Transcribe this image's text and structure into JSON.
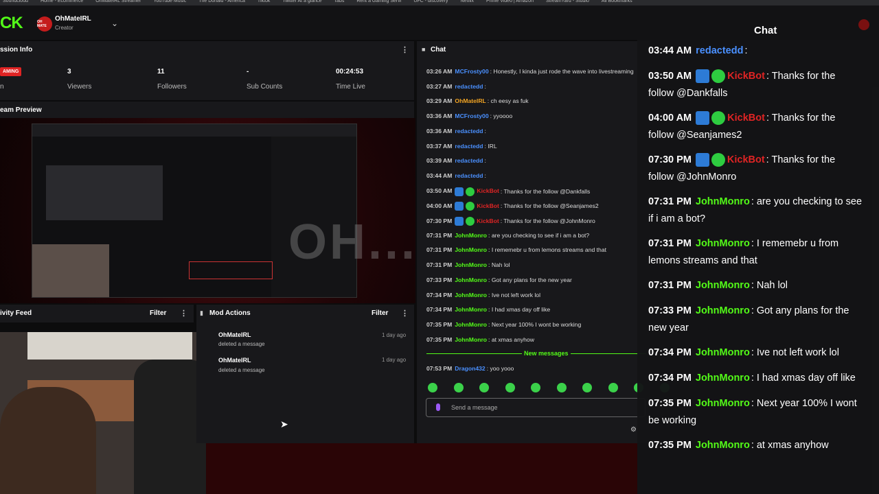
{
  "bookmarks": [
    "Soundcloud",
    "Home - Ecommerce",
    "OhMateIRL Streamer",
    "YouTube Music",
    "The Donald - America",
    "Tiktok",
    "Twitter At a glance",
    "Tabs",
    "Rent a Gaming Servi",
    "UFC - discovery",
    "Netflix",
    "Prime Video | Amazon",
    "StreamYard - Studio",
    "All Bookmarks"
  ],
  "account": {
    "name": "OhMateIRL",
    "role": "Creator",
    "avatar_text": "OH MATE"
  },
  "session_info": {
    "title": "ssion Info",
    "badge": "AMING",
    "side_label": "n",
    "stats": [
      {
        "value": "3",
        "label": "Viewers"
      },
      {
        "value": "11",
        "label": "Followers"
      },
      {
        "value": "-",
        "label": "Sub Counts"
      },
      {
        "value": "00:24:53",
        "label": "Time Live"
      }
    ]
  },
  "stream_preview": {
    "title": "eam Preview",
    "watermark": "OH...MATE"
  },
  "activity_feed": {
    "title": "ivity Feed",
    "filter": "Filter"
  },
  "mod_actions": {
    "title": "Mod Actions",
    "filter": "Filter",
    "items": [
      {
        "user": "OhMateIRL",
        "action": "deleted a message",
        "time": "1 day ago"
      },
      {
        "user": "OhMateIRL",
        "action": "deleted a message",
        "time": "1 day ago"
      }
    ]
  },
  "chat": {
    "title": "Chat",
    "new_messages": "New messages",
    "placeholder": "Send a message",
    "messages": [
      {
        "time": "03:26 AM",
        "user": "MCFrosty00",
        "color": "#4a90ff",
        "text": ": Honestly, I kinda just rode the wave into livestreaming"
      },
      {
        "time": "03:27 AM",
        "user": "redactedd",
        "color": "#4a90ff",
        "text": ":"
      },
      {
        "time": "03:29 AM",
        "user": "OhMateIRL",
        "color": "#f5a623",
        "text": ": ch eesy as fuk"
      },
      {
        "time": "03:36 AM",
        "user": "MCFrosty00",
        "color": "#4a90ff",
        "text": ": yyoooo"
      },
      {
        "time": "03:36 AM",
        "user": "redactedd",
        "color": "#4a90ff",
        "text": ":"
      },
      {
        "time": "03:37 AM",
        "user": "redactedd",
        "color": "#4a90ff",
        "text": ": IRL"
      },
      {
        "time": "03:39 AM",
        "user": "redactedd",
        "color": "#4a90ff",
        "text": ":"
      },
      {
        "time": "03:44 AM",
        "user": "redactedd",
        "color": "#4a90ff",
        "text": ":"
      },
      {
        "time": "03:50 AM",
        "user": "KickBot",
        "color": "#e02424",
        "text": ": Thanks for the follow @Dankfalls"
      },
      {
        "time": "04:00 AM",
        "user": "KickBot",
        "color": "#e02424",
        "text": ": Thanks for the follow @Seanjames2"
      },
      {
        "time": "07:30 PM",
        "user": "KickBot",
        "color": "#e02424",
        "text": ": Thanks for the follow @JohnMonro"
      },
      {
        "time": "07:31 PM",
        "user": "JohnMonro",
        "color": "#53fc18",
        "text": ": are you checking to see if i am a bot?"
      },
      {
        "time": "07:31 PM",
        "user": "JohnMonro",
        "color": "#53fc18",
        "text": ": I rememebr u from lemons streams and that"
      },
      {
        "time": "07:31 PM",
        "user": "JohnMonro",
        "color": "#53fc18",
        "text": ": Nah lol"
      },
      {
        "time": "07:33 PM",
        "user": "JohnMonro",
        "color": "#53fc18",
        "text": ": Got any plans for the new year"
      },
      {
        "time": "07:34 PM",
        "user": "JohnMonro",
        "color": "#53fc18",
        "text": ": Ive not left work lol"
      },
      {
        "time": "07:34 PM",
        "user": "JohnMonro",
        "color": "#53fc18",
        "text": ": I had xmas day off like"
      },
      {
        "time": "07:35 PM",
        "user": "JohnMonro",
        "color": "#53fc18",
        "text": ": Next year 100% I wont be working"
      },
      {
        "time": "07:35 PM",
        "user": "JohnMonro",
        "color": "#53fc18",
        "text": ": at xmas anyhow"
      }
    ],
    "after_new": {
      "time": "07:53 PM",
      "user": "Dragon432",
      "color": "#4a90ff",
      "text": ": yoo yooo"
    }
  },
  "overlay_chat": {
    "title": "Chat",
    "lines": [
      {
        "time": "03:44 AM",
        "user": "redactedd",
        "color": "#4a90ff",
        "text": ":"
      },
      {
        "time": "03:50 AM",
        "user": "KickBot",
        "color": "#e02424",
        "text": ": Thanks for the",
        "cont": "follow @Dankfalls"
      },
      {
        "time": "04:00 AM",
        "user": "KickBot",
        "color": "#e02424",
        "text": ": Thanks for the",
        "cont": "follow @Seanjames2"
      },
      {
        "time": "07:30 PM",
        "user": "KickBot",
        "color": "#e02424",
        "text": ": Thanks for the",
        "cont": "follow @JohnMonro"
      },
      {
        "time": "07:31 PM",
        "user": "JohnMonro",
        "color": "#53fc18",
        "text": ": are you checking to see",
        "cont": "if i am a bot?"
      },
      {
        "time": "07:31 PM",
        "user": "JohnMonro",
        "color": "#53fc18",
        "text": ": I rememebr u from",
        "cont": "lemons streams and that"
      },
      {
        "time": "07:31 PM",
        "user": "JohnMonro",
        "color": "#53fc18",
        "text": ": Nah lol"
      },
      {
        "time": "07:33 PM",
        "user": "JohnMonro",
        "color": "#53fc18",
        "text": ": Got any plans for the",
        "cont": "new year"
      },
      {
        "time": "07:34 PM",
        "user": "JohnMonro",
        "color": "#53fc18",
        "text": ": Ive not left work lol"
      },
      {
        "time": "07:34 PM",
        "user": "JohnMonro",
        "color": "#53fc18",
        "text": ": I had xmas day off like"
      },
      {
        "time": "07:35 PM",
        "user": "JohnMonro",
        "color": "#53fc18",
        "text": ": Next year 100% I wont",
        "cont": "be working"
      },
      {
        "time": "07:35 PM",
        "user": "JohnMonro",
        "color": "#53fc18",
        "text": ": at xmas anyhow"
      }
    ]
  },
  "colors": {
    "kick_green": "#53fc18",
    "live_red": "#e02424",
    "panel": "#18181b"
  }
}
